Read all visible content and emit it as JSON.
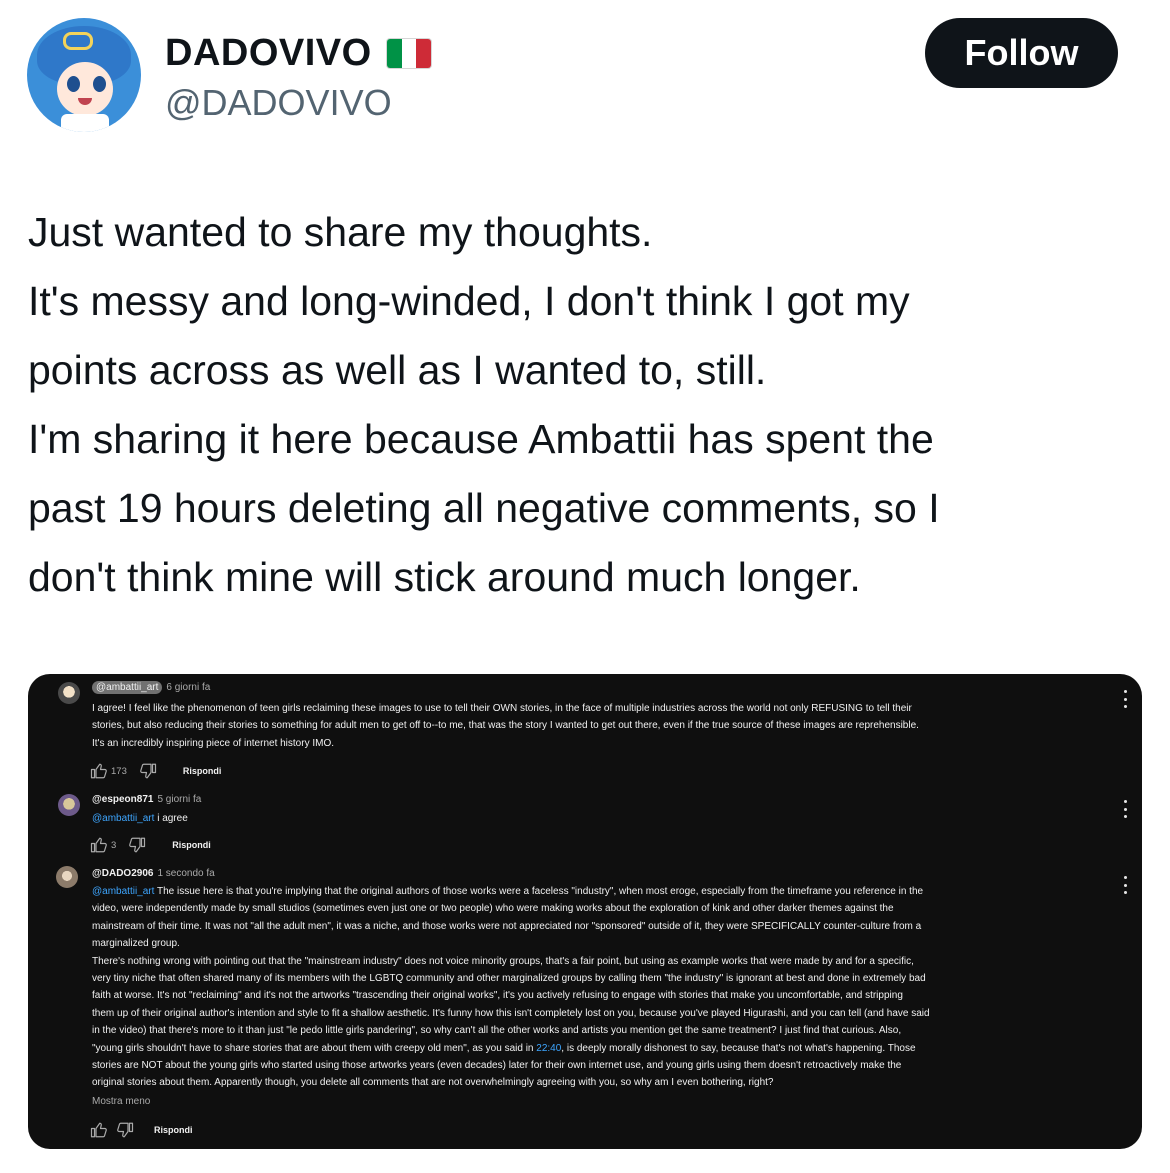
{
  "profile": {
    "display_name": "DADOVIVO",
    "handle": "@DADOVIVO",
    "flag_icon": "italy-flag-icon",
    "flag_colors": [
      "#009246",
      "#ffffff",
      "#ce2b37"
    ],
    "follow_label": "Follow"
  },
  "tweet": {
    "lines": [
      "Just wanted to share my thoughts.",
      "It's messy and long-winded, I don't think I got my",
      "points across as well as I wanted to, still.",
      "I'm sharing it here because Ambattii has spent the",
      "past 19 hours deleting all negative comments, so I",
      "don't think mine will stick around much longer."
    ]
  },
  "screenshot": {
    "comments": [
      {
        "author": "@ambattii_art",
        "time": "6 giorni fa",
        "body_lines": [
          "I agree! I feel like the phenomenon of teen girls reclaiming these images to use to tell their OWN stories, in the face of multiple industries across the world not only REFUSING to tell their",
          "stories, but also reducing their stories to something for adult men to get off to--to me, that was the story I wanted to get out there, even if the true source of these images are reprehensible.",
          "It's an incredibly inspiring piece of internet history IMO."
        ],
        "likes": "173",
        "reply_label": "Rispondi"
      },
      {
        "author": "@espeon871",
        "time": "5 giorni fa",
        "mention": "@ambattii_art",
        "body": "i agree",
        "likes": "3",
        "reply_label": "Rispondi"
      },
      {
        "author": "@DADO2906",
        "time": "1 secondo fa",
        "mention": "@ambattii_art",
        "body_first": "The issue here is that you're implying that the original authors of those works were a faceless \"industry\", when most eroge, especially from the timeframe you reference in the",
        "body_lines": [
          "video, were independently made by small studios (sometimes even just one or two people) who were making works about the exploration of kink and other darker themes against the",
          "mainstream of their time. It was not \"all the adult men\", it was a niche, and those works were not appreciated nor \"sponsored\" outside of it, they were SPECIFICALLY counter-culture from a",
          "marginalized group.",
          "There's nothing wrong with pointing out that the \"mainstream industry\" does not voice minority groups, that's a fair point, but using as example works that were made by and for a specific,",
          "very tiny niche that often shared many of its members with the LGBTQ community and other marginalized groups by calling them \"the industry\" is ignorant at best and done in extremely bad",
          "faith at worse. It's not \"reclaiming\" and it's not the artworks \"trascending their original works\", it's you actively refusing to engage with stories that make you uncomfortable, and stripping",
          "them up of their original author's intention and style to fit a shallow aesthetic. It's funny how this isn't completely lost on you, because you've played Higurashi, and you can tell (and have said",
          "in the video) that there's more to it than just \"le pedo little girls pandering\", so why can't all the other works and artists you mention get the same treatment? I just find that curious. Also,"
        ],
        "ts_line_before": "\"young girls shouldn't have to share stories that are about them with creepy old men\", as you said in ",
        "timestamp": "22:40",
        "ts_line_after": ", is deeply morally dishonest to say, because that's not what's happening. Those",
        "body_tail": [
          "stories are NOT about the young girls who started using those artworks years (even decades) later for their own internet use, and young girls using them doesn't retroactively make the",
          "original stories about them. Apparently though, you delete all comments that are not overwhelmingly agreeing with you, so why am I even bothering, right?"
        ],
        "show_less": "Mostra meno",
        "reply_label": "Rispondi"
      }
    ]
  }
}
